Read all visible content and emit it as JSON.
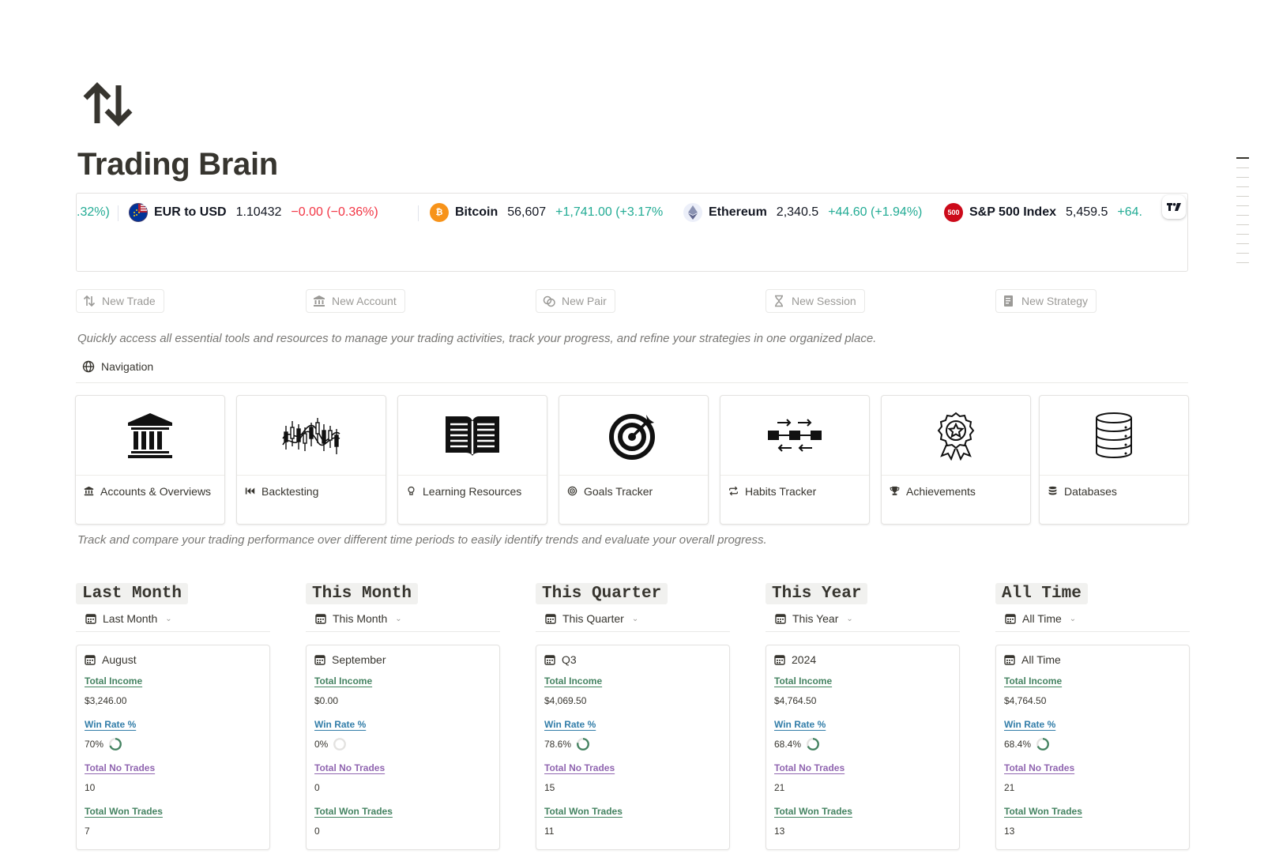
{
  "page": {
    "title": "Trading Brain",
    "icon": "up-down-arrows-icon"
  },
  "ticker": {
    "fragment_left": ".32%)",
    "items": [
      {
        "name": "EUR to USD",
        "price": "1.10432",
        "change": "−0.00 (−0.36%)",
        "direction": "down",
        "logo": "eu-us-flag-icon"
      },
      {
        "name": "Bitcoin",
        "price": "56,607",
        "change": "+1,741.00 (+3.17%",
        "direction": "up",
        "logo": "bitcoin-icon"
      },
      {
        "name": "Ethereum",
        "price": "2,340.5",
        "change": "+44.60 (+1.94%)",
        "direction": "up",
        "logo": "ethereum-icon"
      },
      {
        "name": "S&P 500 Index",
        "price": "5,459.5",
        "change": "+64.",
        "direction": "up",
        "logo": "sp500-icon",
        "logo_text": "500"
      }
    ],
    "badge": "TV"
  },
  "actions": [
    {
      "label": "New Trade",
      "icon": "up-down-arrows-icon"
    },
    {
      "label": "New Account",
      "icon": "bank-icon"
    },
    {
      "label": "New Pair",
      "icon": "coins-icon"
    },
    {
      "label": "New Session",
      "icon": "hourglass-icon"
    },
    {
      "label": "New Strategy",
      "icon": "notebook-icon"
    }
  ],
  "description_1": "Quickly access all essential tools and resources to manage your trading activities, track your progress, and refine your strategies in one organized place.",
  "navigation": {
    "label": "Navigation",
    "cards": [
      {
        "title": "Accounts & Overviews",
        "icon": "bank-icon"
      },
      {
        "title": "Backtesting",
        "icon": "rewind-icon"
      },
      {
        "title": "Learning Resources",
        "icon": "lightbulb-icon"
      },
      {
        "title": "Goals Tracker",
        "icon": "target-icon"
      },
      {
        "title": "Habits Tracker",
        "icon": "repeat-icon"
      },
      {
        "title": "Achievements",
        "icon": "trophy-icon"
      },
      {
        "title": "Databases",
        "icon": "database-icon"
      }
    ]
  },
  "description_2": "Track and compare your trading performance over different time periods to easily identify trends and evaluate your overall progress.",
  "labels": {
    "total_income": "Total Income",
    "win_rate": "Win Rate %",
    "total_no_trades": "Total No Trades",
    "total_won_trades": "Total Won Trades"
  },
  "periods": [
    {
      "heading": "Last Month",
      "view": "Last Month",
      "card_title": "August",
      "total_income": "$3,246.00",
      "win_rate": "70%",
      "win_rate_fraction": 0.7,
      "total_no_trades": "10",
      "total_won_trades": "7"
    },
    {
      "heading": "This Month",
      "view": "This Month",
      "card_title": "September",
      "total_income": "$0.00",
      "win_rate": "0%",
      "win_rate_fraction": 0.0,
      "total_no_trades": "0",
      "total_won_trades": "0"
    },
    {
      "heading": "This Quarter",
      "view": "This Quarter",
      "card_title": "Q3",
      "total_income": "$4,069.50",
      "win_rate": "78.6%",
      "win_rate_fraction": 0.786,
      "total_no_trades": "15",
      "total_won_trades": "11"
    },
    {
      "heading": "This Year",
      "view": "This Year",
      "card_title": "2024",
      "total_income": "$4,764.50",
      "win_rate": "68.4%",
      "win_rate_fraction": 0.684,
      "total_no_trades": "21",
      "total_won_trades": "13"
    },
    {
      "heading": "All Time",
      "view": "All Time",
      "card_title": "All Time",
      "total_income": "$4,764.50",
      "win_rate": "68.4%",
      "win_rate_fraction": 0.684,
      "total_no_trades": "21",
      "total_won_trades": "13"
    }
  ],
  "colors": {
    "positive": "#22ab94",
    "negative": "#f23645",
    "label_green": "#448361",
    "label_blue": "#337ea9",
    "label_purple": "#9065b0"
  }
}
